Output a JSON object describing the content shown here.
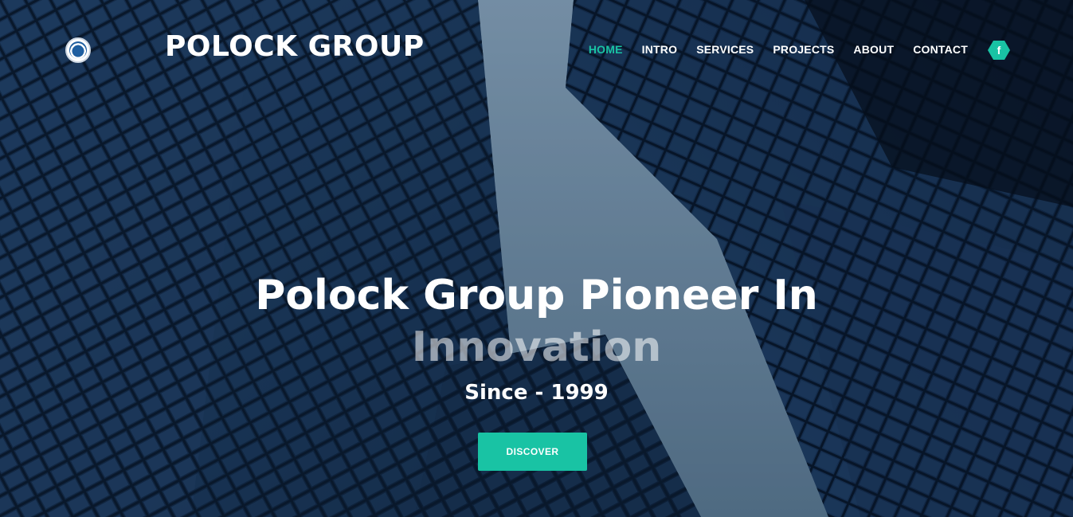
{
  "brand": {
    "name": "POLOCK GROUP"
  },
  "nav": {
    "items": [
      {
        "label": "HOME",
        "active": true
      },
      {
        "label": "INTRO"
      },
      {
        "label": "SERVICES"
      },
      {
        "label": "PROJECTS"
      },
      {
        "label": "ABOUT"
      },
      {
        "label": "CONTACT"
      }
    ],
    "social": {
      "icon": "facebook-icon",
      "glyph": "f"
    }
  },
  "hero": {
    "line1": "Polock Group Pioneer In",
    "line2": "Innovation",
    "since": "Since - 1999",
    "cta": "DISCOVER"
  },
  "colors": {
    "accent": "#19c3a4"
  }
}
